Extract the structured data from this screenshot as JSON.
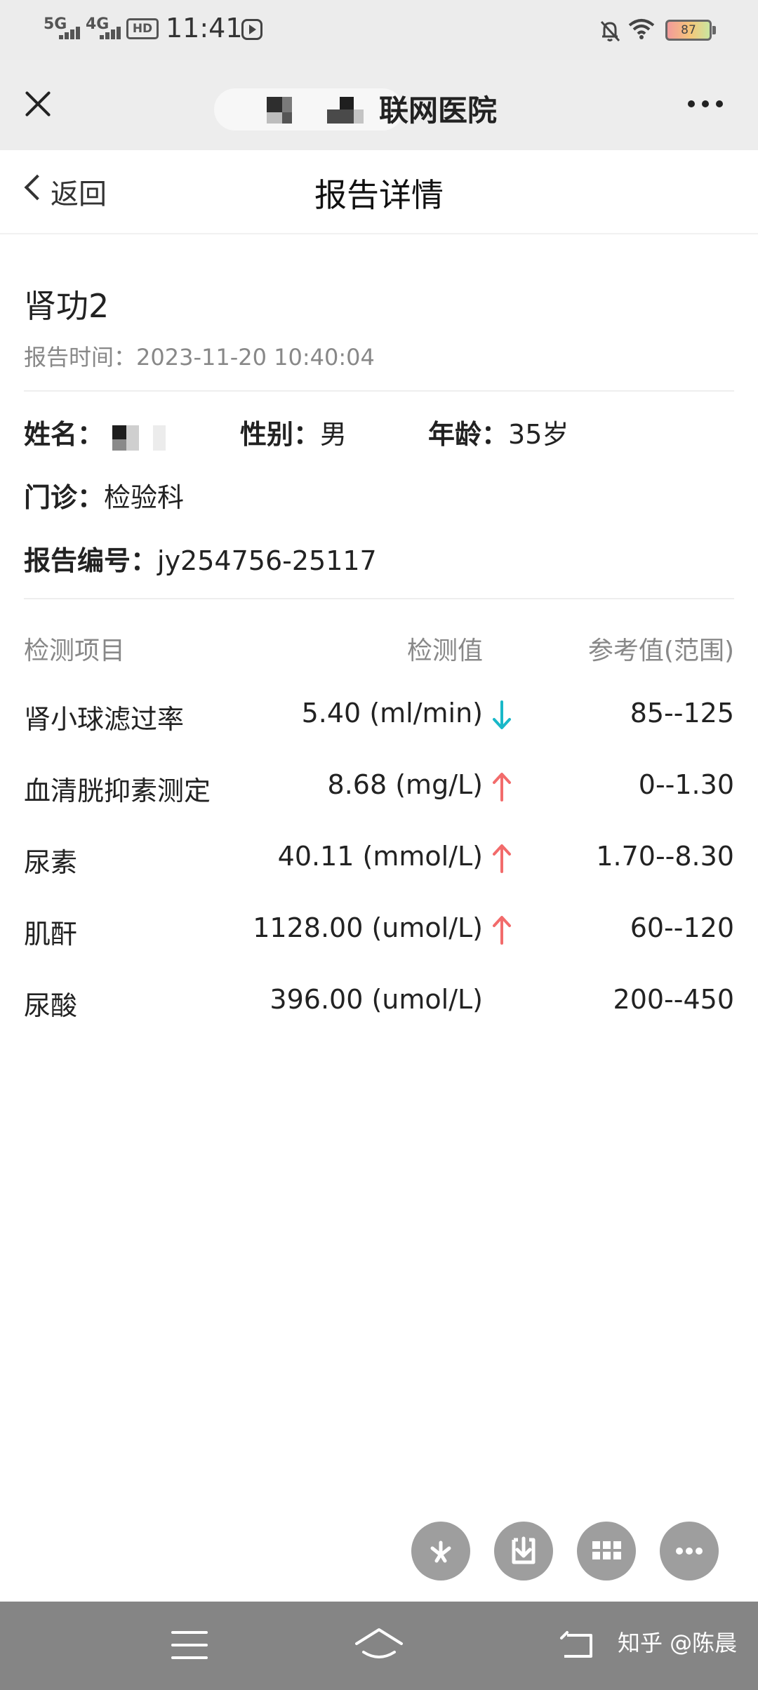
{
  "status_bar": {
    "net1": "5G",
    "net2": "4G",
    "hd": "HD",
    "time": "11:41",
    "battery": "87"
  },
  "title_bar": {
    "title": "联网医院"
  },
  "nav": {
    "back_label": "返回",
    "page_title": "报告详情"
  },
  "report": {
    "name": "肾功2",
    "time_label": "报告时间：",
    "time_value": "2023-11-20 10:40:04"
  },
  "patient": {
    "name_label": "姓名：",
    "gender_label": "性别：",
    "gender_value": "男",
    "age_label": "年龄：",
    "age_value": "35岁",
    "clinic_label": "门诊：",
    "clinic_value": "检验科",
    "report_no_label": "报告编号：",
    "report_no_value": "jy254756-25117"
  },
  "table": {
    "headers": [
      "检测项目",
      "检测值",
      "参考值(范围)"
    ],
    "rows": [
      {
        "item": "肾小球滤过率",
        "value": "5.40 (ml/min)",
        "flag": "down",
        "ref": "85--125"
      },
      {
        "item": "血清胱抑素测定",
        "value": "8.68 (mg/L)",
        "flag": "up",
        "ref": "0--1.30"
      },
      {
        "item": "尿素",
        "value": "40.11 (mmol/L)",
        "flag": "up",
        "ref": "1.70--8.30"
      },
      {
        "item": "肌酐",
        "value": "1128.00 (umol/L)",
        "flag": "up",
        "ref": "60--120"
      },
      {
        "item": "尿酸",
        "value": "396.00 (umol/L)",
        "flag": "none",
        "ref": "200--450"
      }
    ]
  },
  "colors": {
    "up_arrow": "#f26b6b",
    "down_arrow": "#19b8c8",
    "fab": "#9e9e9e",
    "system_nav": "#858585"
  },
  "icons": {
    "fab_1": "spark-icon",
    "fab_2": "download-icon",
    "fab_3": "grid-icon",
    "fab_4": "more-icon",
    "nav_1": "menu-icon",
    "nav_2": "home-icon",
    "nav_3": "back-icon"
  },
  "watermark": "知乎 @陈晨"
}
